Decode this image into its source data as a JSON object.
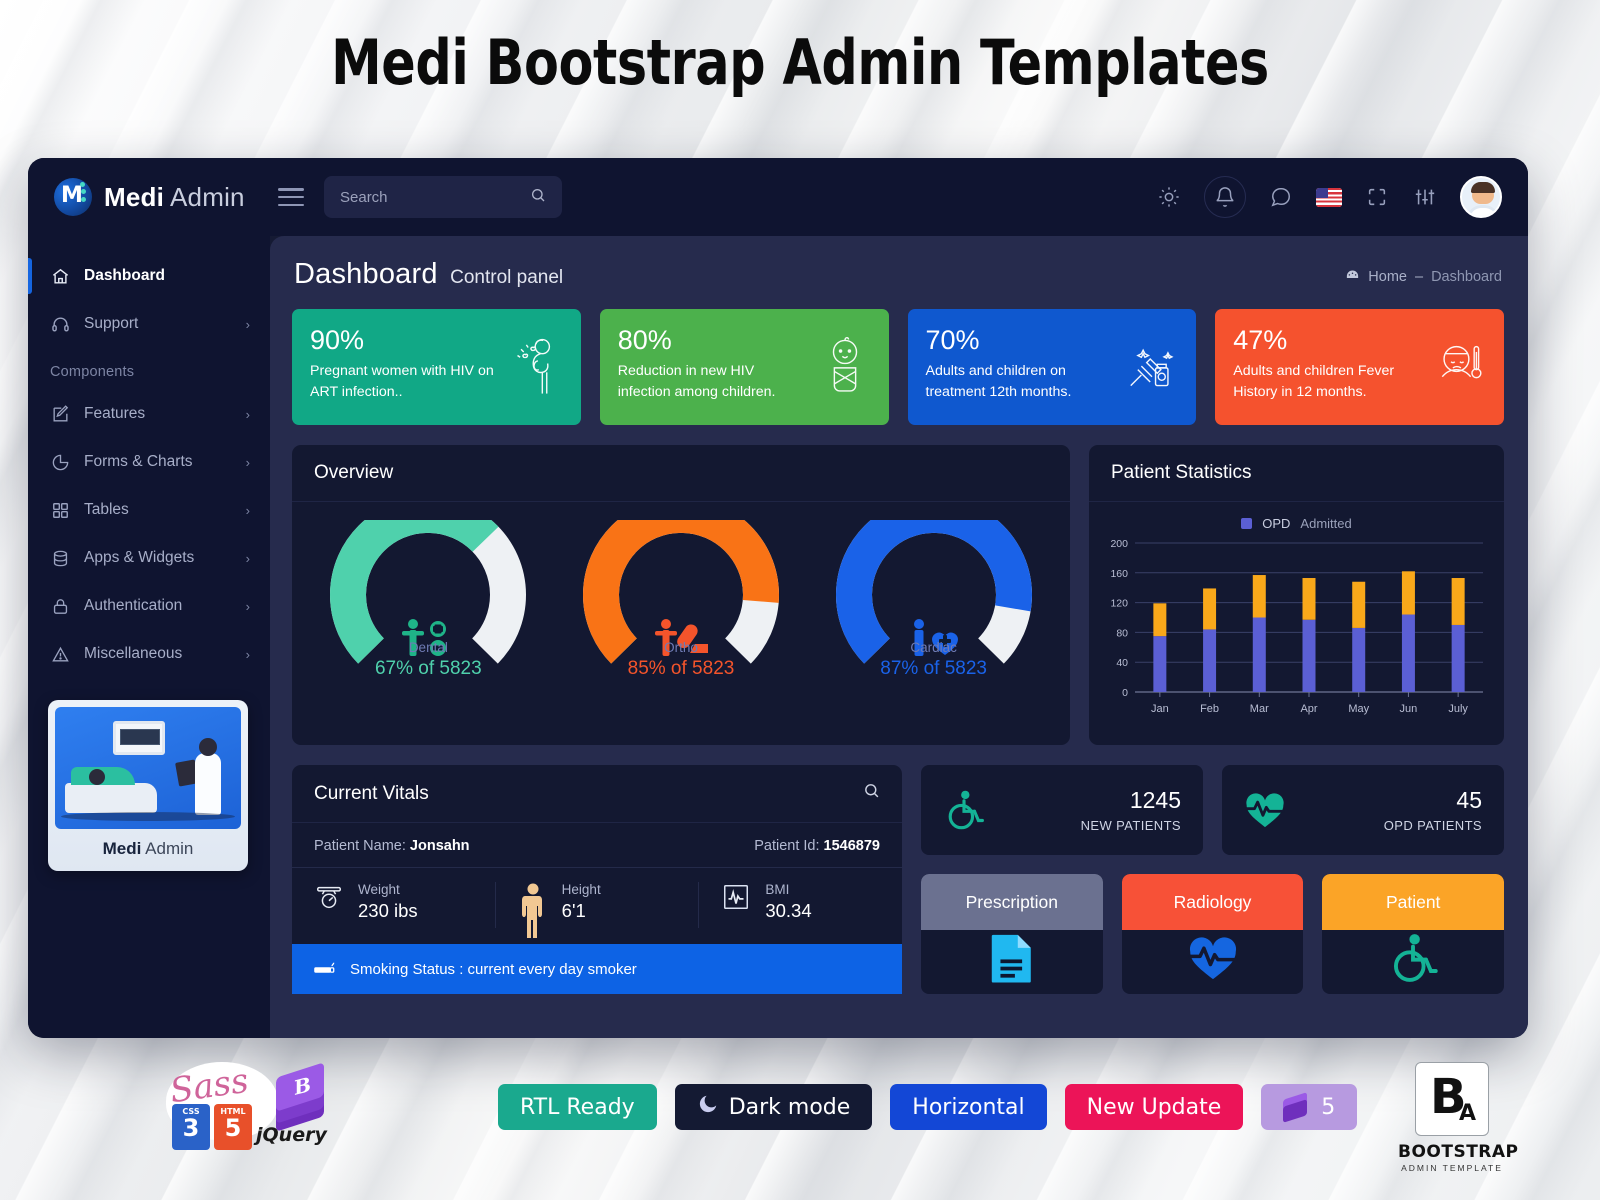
{
  "page": {
    "headline": "Medi Bootstrap Admin Templates"
  },
  "topbar": {
    "brand_bold": "Medi",
    "brand_light": " Admin",
    "menu_toggle": "hamburger-menu",
    "search": {
      "value": "",
      "placeholder": "Search",
      "icon": "search-icon"
    },
    "icons": [
      {
        "name": "brightness-icon",
        "glyph": "☀"
      },
      {
        "name": "notification-bell-icon",
        "glyph": "🔔"
      },
      {
        "name": "chat-bubble-icon",
        "glyph": "💬"
      },
      {
        "name": "language-flag-icon",
        "glyph": "flag-us"
      },
      {
        "name": "fullscreen-icon",
        "glyph": "⛶"
      },
      {
        "name": "settings-sliders-icon",
        "glyph": "⚙"
      },
      {
        "name": "user-avatar",
        "glyph": "avatar"
      }
    ]
  },
  "sidebar": {
    "items": [
      {
        "label": "Dashboard",
        "icon": "home-icon",
        "active": true,
        "has_chevron": false
      },
      {
        "label": "Support",
        "icon": "headset-icon",
        "active": false,
        "has_chevron": true
      }
    ],
    "section_label": "Components",
    "component_items": [
      {
        "label": "Features",
        "icon": "edit-square-icon",
        "has_chevron": true
      },
      {
        "label": "Forms & Charts",
        "icon": "pie-chart-icon",
        "has_chevron": true
      },
      {
        "label": "Tables",
        "icon": "grid-icon",
        "has_chevron": true
      },
      {
        "label": "Apps & Widgets",
        "icon": "database-icon",
        "has_chevron": true
      },
      {
        "label": "Authentication",
        "icon": "lock-icon",
        "has_chevron": true
      },
      {
        "label": "Miscellaneous",
        "icon": "warning-triangle-icon",
        "has_chevron": true
      }
    ],
    "promo": {
      "image_alt": "doctor-and-patient-illustration",
      "title_bold": "Medi",
      "title_light": " Admin"
    }
  },
  "content": {
    "title": "Dashboard",
    "subtitle": "Control panel",
    "breadcrumb": {
      "icon": "dashboard-icon",
      "home": "Home",
      "separator": "–",
      "current": "Dashboard"
    },
    "stat_cards": [
      {
        "percent": "90%",
        "desc": "Pregnant women with HIV on ART infection..",
        "color": "#11a886",
        "icon": "pregnant-woman-icon"
      },
      {
        "percent": "80%",
        "desc": "Reduction in new HIV infection among children.",
        "color": "#4cb14c",
        "icon": "baby-icon"
      },
      {
        "percent": "70%",
        "desc": "Adults and children on treatment 12th months.",
        "color": "#0f58cf",
        "icon": "syringe-medicine-icon"
      },
      {
        "percent": "47%",
        "desc": "Adults and children Fever History in 12 months.",
        "color": "#f5522e",
        "icon": "fever-patient-icon"
      }
    ],
    "overview": {
      "title": "Overview",
      "gauges": [
        {
          "name": "Dental",
          "value_text": "67% of 5823",
          "percent": 67,
          "color": "#4fd1ac",
          "icon": "patient-plus-minus-icon"
        },
        {
          "name": "Ortho",
          "value_text": "85% of 5823",
          "percent": 85,
          "color": "#f97316",
          "icon": "patient-pills-icon"
        },
        {
          "name": "Cardiac",
          "value_text": "87% of 5823",
          "percent": 87,
          "color": "#1a62e8",
          "icon": "patient-heart-icon"
        }
      ]
    },
    "patient_statistics": {
      "title": "Patient Statistics"
    },
    "vitals": {
      "title": "Current Vitals",
      "search_icon": "search-icon",
      "patient_name_label": "Patient Name:",
      "patient_name": "Jonsahn",
      "patient_id_label": "Patient Id:",
      "patient_id": "1546879",
      "cells": [
        {
          "label": "Weight",
          "value": "230 ibs",
          "icon": "weight-scale-icon"
        },
        {
          "label": "Height",
          "value": "6'1",
          "icon": "body-height-icon"
        },
        {
          "label": "BMI",
          "value": "30.34",
          "icon": "bmi-monitor-icon"
        }
      ],
      "smoking_status": "Smoking Status : current every day smoker",
      "smoking_icon": "cigarette-icon"
    },
    "kpis": [
      {
        "number": "1245",
        "label": "NEW PATIENTS",
        "icon": "wheelchair-icon",
        "color": "#14b396"
      },
      {
        "number": "45",
        "label": "OPD PATIENTS",
        "icon": "heartbeat-icon",
        "color": "#14b396"
      }
    ],
    "tiles": [
      {
        "label": "Prescription",
        "header_color": "#6b7190",
        "icon": "document-lines-icon",
        "icon_color": "#20b8f0"
      },
      {
        "label": "Radiology",
        "header_color": "#f75137",
        "icon": "heartbeat-icon",
        "icon_color": "#1566e0"
      },
      {
        "label": "Patient",
        "header_color": "#fba427",
        "icon": "wheelchair-icon",
        "icon_color": "#14b396"
      }
    ]
  },
  "chart_data": {
    "type": "bar",
    "title": "Patient Statistics",
    "categories": [
      "Jan",
      "Feb",
      "Mar",
      "Apr",
      "May",
      "Jun",
      "July"
    ],
    "series": [
      {
        "name": "OPD",
        "color": "#5b5fd4",
        "values": [
          75,
          84,
          100,
          97,
          86,
          104,
          90
        ]
      },
      {
        "name": "Admitted",
        "color": "#f9a81a",
        "values": [
          44,
          55,
          57,
          56,
          62,
          58,
          63
        ]
      }
    ],
    "stacked": true,
    "legend": [
      "OPD",
      "Admitted"
    ],
    "legend_position": "top-center",
    "yticks": [
      0,
      40,
      80,
      120,
      160,
      200
    ],
    "ylim": [
      0,
      200
    ],
    "xlabel": "",
    "ylabel": "",
    "grid": true
  },
  "footer_badges": {
    "tech_logos": [
      "sass-logo",
      "css3-logo",
      "html5-logo",
      "jquery-logo",
      "bootstrap-gem-logo"
    ],
    "pills": [
      {
        "label": "RTL Ready",
        "color": "#1aa98e",
        "icon": null
      },
      {
        "label": "Dark mode",
        "color": "#141a33",
        "icon": "moon-icon"
      },
      {
        "label": "Horizontal",
        "color": "#1347d6",
        "icon": null
      },
      {
        "label": "New Update",
        "color": "#ec1458",
        "icon": null
      },
      {
        "label": "5",
        "color": "#b79ae0",
        "icon": "bootstrap-gem-icon"
      }
    ],
    "brand": {
      "letter_big": "B",
      "letter_small": "A",
      "line1": "BOOTSTRAP",
      "line2": "ADMIN TEMPLATE"
    }
  }
}
